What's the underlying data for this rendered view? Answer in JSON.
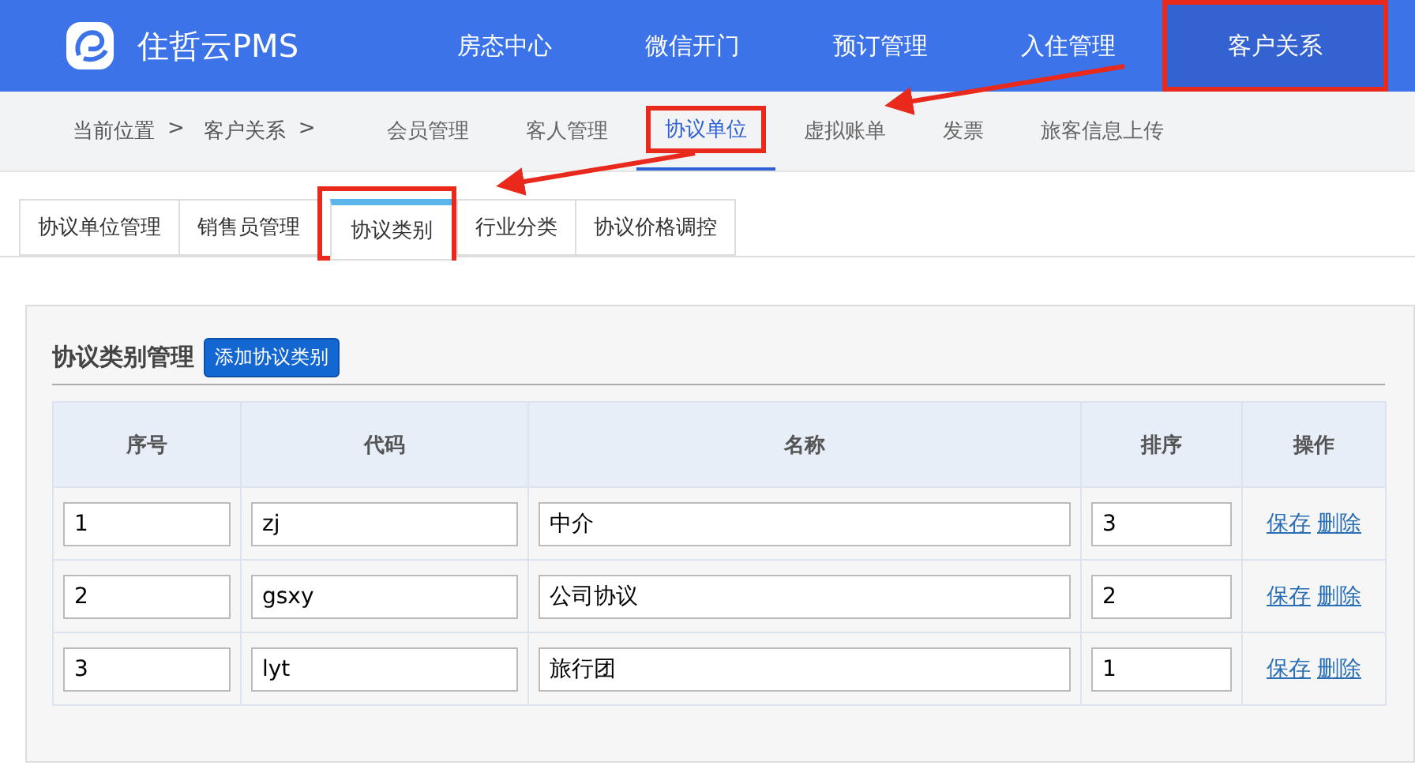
{
  "header": {
    "brand": "住哲云PMS",
    "nav": [
      {
        "label": "房态中心",
        "selected": false,
        "annotated": false
      },
      {
        "label": "微信开门",
        "selected": false,
        "annotated": false
      },
      {
        "label": "预订管理",
        "selected": false,
        "annotated": false
      },
      {
        "label": "入住管理",
        "selected": false,
        "annotated": false
      },
      {
        "label": "客户关系",
        "selected": true,
        "annotated": true
      }
    ]
  },
  "subbar": {
    "breadcrumb": [
      "当前位置",
      "客户关系"
    ],
    "separator": ">",
    "items": [
      {
        "label": "会员管理",
        "selected": false,
        "annotated": false
      },
      {
        "label": "客人管理",
        "selected": false,
        "annotated": false
      },
      {
        "label": "协议单位",
        "selected": true,
        "annotated": true
      },
      {
        "label": "虚拟账单",
        "selected": false,
        "annotated": false
      },
      {
        "label": "发票",
        "selected": false,
        "annotated": false
      },
      {
        "label": "旅客信息上传",
        "selected": false,
        "annotated": false
      }
    ]
  },
  "tabs": [
    {
      "label": "协议单位管理",
      "selected": false,
      "annotated": false
    },
    {
      "label": "销售员管理",
      "selected": false,
      "annotated": false
    },
    {
      "label": "协议类别",
      "selected": true,
      "annotated": true
    },
    {
      "label": "行业分类",
      "selected": false,
      "annotated": false
    },
    {
      "label": "协议价格调控",
      "selected": false,
      "annotated": false
    }
  ],
  "panel": {
    "title": "协议类别管理",
    "add_button": "添加协议类别",
    "table": {
      "columns": [
        "序号",
        "代码",
        "名称",
        "排序",
        "操作"
      ],
      "rows": [
        {
          "index": "1",
          "code": "zj",
          "name": "中介",
          "order": "3",
          "actions": [
            "保存",
            "删除"
          ]
        },
        {
          "index": "2",
          "code": "gsxy",
          "name": "公司协议",
          "order": "2",
          "actions": [
            "保存",
            "删除"
          ]
        },
        {
          "index": "3",
          "code": "lyt",
          "name": "旅行团",
          "order": "1",
          "actions": [
            "保存",
            "删除"
          ]
        }
      ]
    }
  }
}
